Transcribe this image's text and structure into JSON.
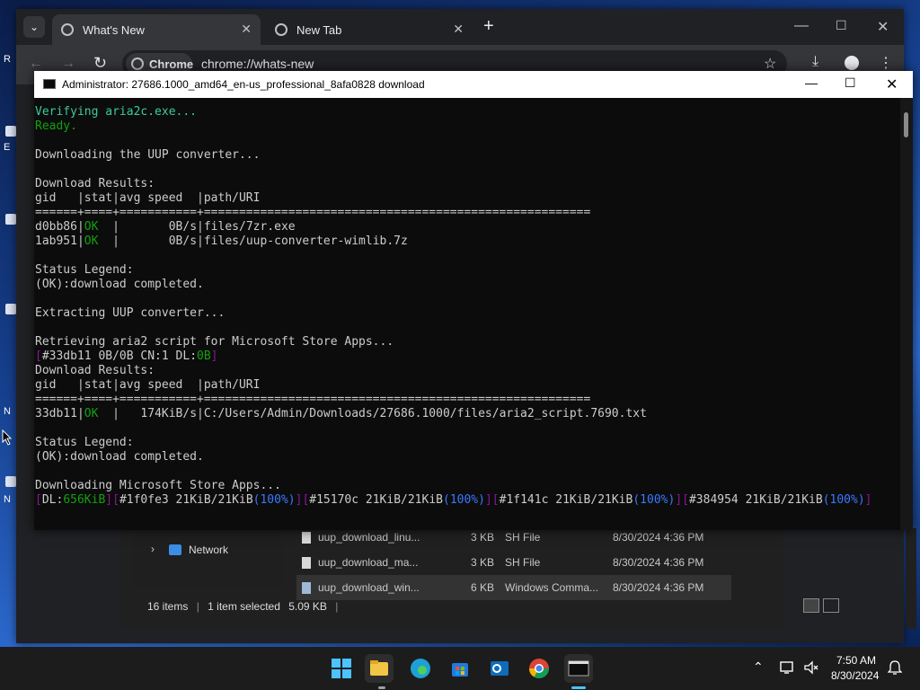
{
  "desktop": {
    "icon_labels": [
      "R",
      "E",
      "N",
      "N"
    ]
  },
  "chrome": {
    "tabs": [
      {
        "label": "What's New"
      },
      {
        "label": "New Tab"
      }
    ],
    "new_tab_symbol": "+",
    "site_chip": "Chrome",
    "url": "chrome://whats-new"
  },
  "cmd": {
    "title": "Administrator:  27686.1000_amd64_en-us_professional_8afa0828 download",
    "lines": {
      "l1": "Verifying aria2c.exe...",
      "l2": "Ready.",
      "l3": "Downloading the UUP converter...",
      "l4": "Download Results:",
      "l5": "gid   |stat|avg speed  |path/URI",
      "l6": "======+====+===========+=======================================================",
      "l7a": "d0bb86|",
      "l7b": "OK",
      "l7c": "  |       0B/s|files/7zr.exe",
      "l8a": "1ab951|",
      "l8b": "OK",
      "l8c": "  |       0B/s|files/uup-converter-wimlib.7z",
      "l9": "Status Legend:",
      "l10": "(OK):download completed.",
      "l11": "Extracting UUP converter...",
      "l12": "Retrieving aria2 script for Microsoft Store Apps...",
      "l13a": "[",
      "l13b": "#33db11 0B/0B CN:1 DL:",
      "l13c": "0B",
      "l13d": "]",
      "l14": "Download Results:",
      "l15": "gid   |stat|avg speed  |path/URI",
      "l16": "======+====+===========+=======================================================",
      "l17a": "33db11|",
      "l17b": "OK",
      "l17c": "  |   174KiB/s|C:/Users/Admin/Downloads/27686.1000/files/aria2_script.7690.txt",
      "l18": "Status Legend:",
      "l19": "(OK):download completed.",
      "l20": "Downloading Microsoft Store Apps...",
      "l21a": "[",
      "l21b": "DL:",
      "l21c": "656KiB",
      "l21d": "][",
      "l21e": "#1f0fe3 21KiB/21KiB",
      "l21f": "(100%)",
      "l21g": "][",
      "l21h": "#15170c 21KiB/21KiB",
      "l21i": "(100%)",
      "l21j": "][",
      "l21k": "#1f141c 21KiB/21KiB",
      "l21l": "(100%)",
      "l21m": "][",
      "l21n": "#384954 21KiB/21KiB",
      "l21o": "(100%)",
      "l21p": "]"
    }
  },
  "explorer": {
    "nav_item": "Network",
    "files": [
      {
        "name": "uup_download_linu...",
        "size": "3 KB",
        "type": "SH File",
        "date": "8/30/2024 4:36 PM"
      },
      {
        "name": "uup_download_ma...",
        "size": "3 KB",
        "type": "SH File",
        "date": "8/30/2024 4:36 PM"
      },
      {
        "name": "uup_download_win...",
        "size": "6 KB",
        "type": "Windows Comma...",
        "date": "8/30/2024 4:36 PM"
      }
    ],
    "status": {
      "items": "16 items",
      "selected": "1 item selected",
      "size": "5.09 KB"
    }
  },
  "taskbar": {
    "time": "7:50 AM",
    "date": "8/30/2024"
  },
  "colors": {
    "ok_green": "#13a10e",
    "prompt_teal": "#3ccb9a",
    "percent_blue": "#3b78ff",
    "bracket_purple": "#881798"
  }
}
